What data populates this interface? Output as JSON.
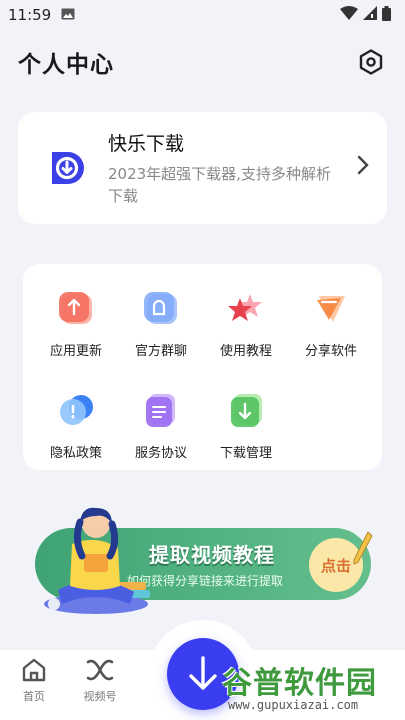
{
  "status": {
    "time": "11:59"
  },
  "header": {
    "title": "个人中心"
  },
  "app_card": {
    "name": "快乐下载",
    "description": "2023年超强下载器,支持多种解析下载"
  },
  "menu": {
    "items": [
      {
        "label": "应用更新",
        "icon": "app-update-icon"
      },
      {
        "label": "官方群聊",
        "icon": "group-chat-icon"
      },
      {
        "label": "使用教程",
        "icon": "tutorial-icon"
      },
      {
        "label": "分享软件",
        "icon": "share-app-icon"
      },
      {
        "label": "隐私政策",
        "icon": "privacy-policy-icon"
      },
      {
        "label": "服务协议",
        "icon": "service-agreement-icon"
      },
      {
        "label": "下载管理",
        "icon": "download-manager-icon"
      }
    ]
  },
  "banner": {
    "title": "提取视频教程",
    "subtitle": "如何获得分享链接来进行提取",
    "button": "点击"
  },
  "bottom_nav": {
    "items": [
      {
        "label": "首页",
        "icon": "home-icon"
      },
      {
        "label": "视频号",
        "icon": "video-channel-icon"
      }
    ]
  },
  "watermark": {
    "title": "谷普软件园",
    "url": "www.gupuxiazai.com"
  },
  "colors": {
    "accent": "#3a3ef0",
    "banner": "#3fa374",
    "background": "#f1f3f8"
  }
}
